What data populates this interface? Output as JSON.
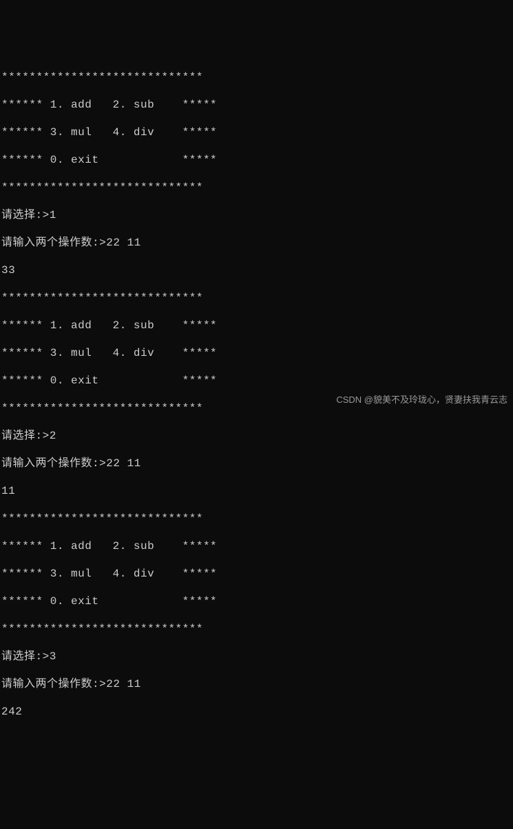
{
  "menu": {
    "border": "*****************************",
    "row1": "****** 1. add   2. sub    *****",
    "row2": "****** 3. mul   4. div    *****",
    "row3": "****** 0. exit            *****"
  },
  "prompts": {
    "select": "请选择:>",
    "operands": "请输入两个操作数:>"
  },
  "sessions": [
    {
      "choice": "1",
      "input": "22 11",
      "result": "33"
    },
    {
      "choice": "2",
      "input": "22 11",
      "result": "11"
    },
    {
      "choice": "3",
      "input": "22 11",
      "result": "242"
    }
  ],
  "watermark": "CSDN @貌美不及玲珑心，贤妻扶我青云志"
}
